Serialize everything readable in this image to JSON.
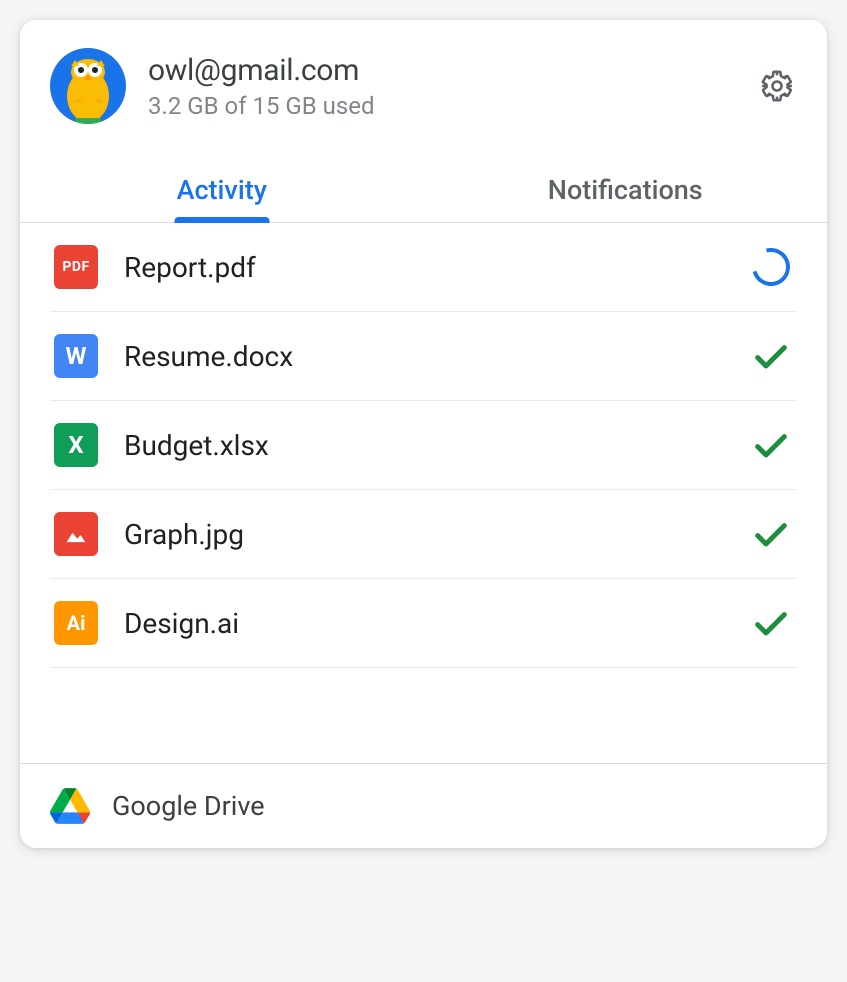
{
  "account": {
    "email": "owl@gmail.com",
    "storage": "3.2 GB of 15 GB used"
  },
  "tabs": {
    "activity": "Activity",
    "notifications": "Notifications",
    "active": "activity"
  },
  "files": [
    {
      "name": "Report.pdf",
      "type": "pdf",
      "glyph": "PDF",
      "status": "syncing"
    },
    {
      "name": "Resume.docx",
      "type": "docx",
      "glyph": "W",
      "status": "done"
    },
    {
      "name": "Budget.xlsx",
      "type": "xlsx",
      "glyph": "X",
      "status": "done"
    },
    {
      "name": "Graph.jpg",
      "type": "jpg",
      "glyph": "",
      "status": "done"
    },
    {
      "name": "Design.ai",
      "type": "ai",
      "glyph": "Ai",
      "status": "done"
    }
  ],
  "footer": {
    "app": "Google Drive"
  },
  "colors": {
    "primary": "#1a73e8",
    "success": "#1e8e3e"
  }
}
